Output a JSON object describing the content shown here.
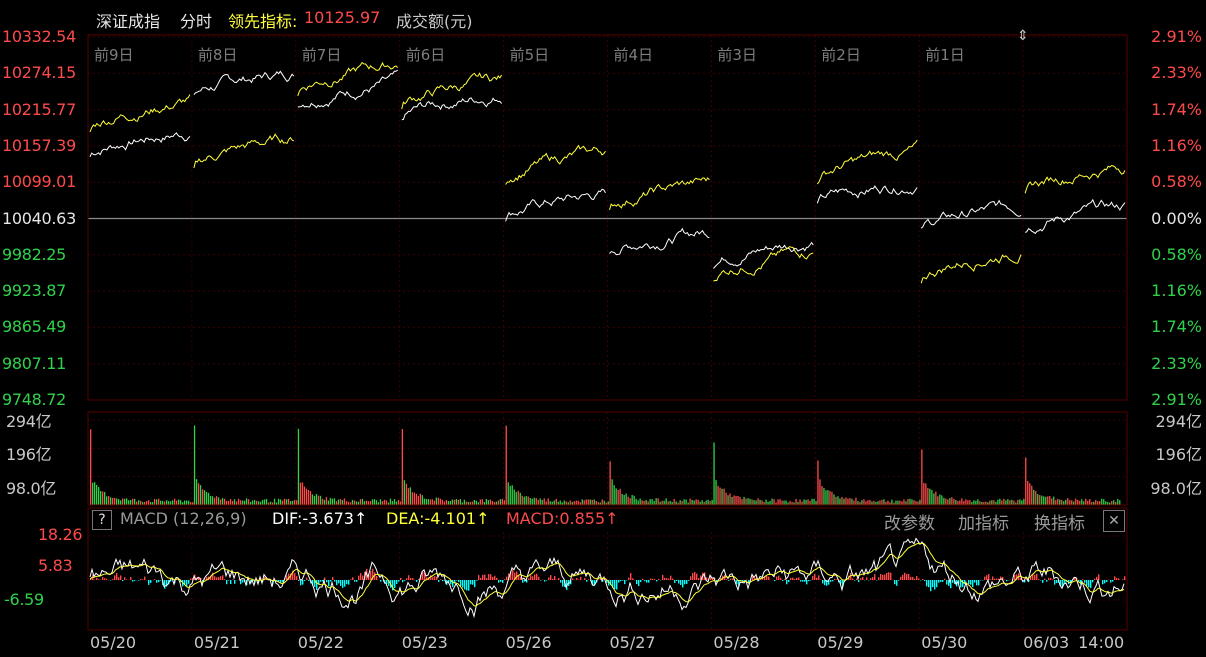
{
  "header": {
    "index_name": "深证成指",
    "mode": "分时",
    "leading_label": "领先指标:",
    "leading_value": "10125.97",
    "volume_label": "成交额(元)"
  },
  "price_axis": {
    "left_labels": [
      "10332.54",
      "10274.15",
      "10215.77",
      "10157.39",
      "10099.01",
      "10040.63",
      "9982.25",
      "9923.87",
      "9865.49",
      "9807.11",
      "9748.72"
    ],
    "right_labels": [
      "2.91%",
      "2.33%",
      "1.74%",
      "1.16%",
      "0.58%",
      "0.00%",
      "0.58%",
      "1.16%",
      "1.74%",
      "2.33%",
      "2.91%"
    ],
    "base_value": 10040.63
  },
  "day_labels": [
    "前9日",
    "前8日",
    "前7日",
    "前6日",
    "前5日",
    "前4日",
    "前3日",
    "前2日",
    "前1日"
  ],
  "volume_axis": {
    "labels": [
      "294亿",
      "196亿",
      "98.0亿"
    ],
    "unit": "亿"
  },
  "macd": {
    "help": "?",
    "title": "MACD (12,26,9)",
    "dif": "DIF:-3.673↑",
    "dea": "DEA:-4.101↑",
    "macd": "MACD:0.855↑",
    "labels": [
      "18.26",
      "5.83",
      "-6.59"
    ],
    "buttons": {
      "params": "改参数",
      "add": "加指标",
      "switch": "换指标",
      "close": "✕"
    }
  },
  "x_labels": [
    "05/20",
    "05/21",
    "05/22",
    "05/23",
    "05/26",
    "05/27",
    "05/28",
    "05/29",
    "05/30",
    "06/03",
    "14:00"
  ],
  "colors": {
    "up": "#ff4a4a",
    "down": "#2fd24a",
    "white_line": "#ffffff",
    "yellow_line": "#ffff3a",
    "cyan": "#00ffff",
    "grid": "#3a0000"
  },
  "chart_data": {
    "type": "line",
    "title": "深证成指 分时",
    "ylim": [
      9748.72,
      10332.54
    ],
    "x": [
      "05/20",
      "05/21",
      "05/22",
      "05/23",
      "05/26",
      "05/27",
      "05/28",
      "05/29",
      "05/30",
      "06/03"
    ],
    "series": [
      {
        "name": "深证成指",
        "values": [
          10180,
          10275,
          10260,
          10240,
          10080,
          10020,
          10005,
          10100,
          10060,
          10060
        ]
      },
      {
        "name": "领先指标",
        "values": [
          10230,
          10170,
          10290,
          10265,
          10150,
          10100,
          9990,
          10150,
          9990,
          10125.97
        ]
      }
    ]
  }
}
